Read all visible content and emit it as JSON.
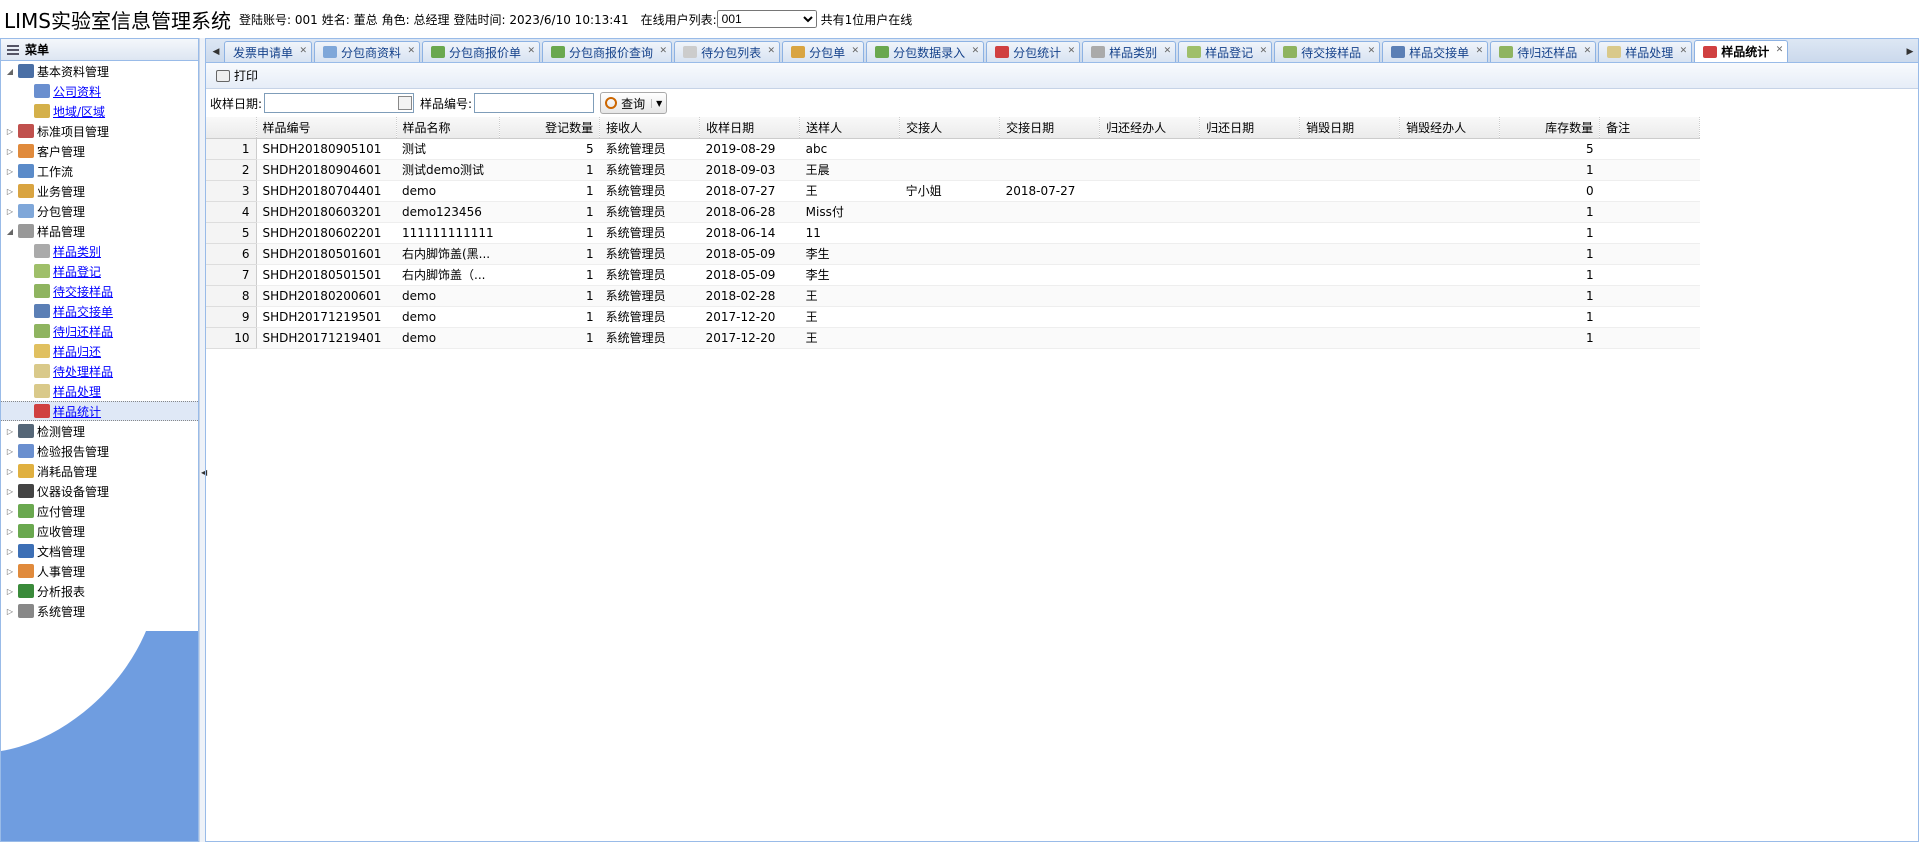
{
  "header": {
    "title": "LIMS实验室信息管理系统",
    "login_account": "登陆账号: 001",
    "name": "姓名: 董总",
    "role": "角色: 总经理",
    "login_time": "登陆时间: 2023/6/10 10:13:41",
    "online_label": "在线用户列表:",
    "online_selected": "001",
    "online_count": "共有1位用户在线"
  },
  "sidebar": {
    "title": "菜单",
    "items": [
      {
        "label": "基本资料管理",
        "expanded": true,
        "icon": "book-icon",
        "color": "#4a6fa5"
      },
      {
        "label": "公司资料",
        "child": true,
        "icon": "edit-icon",
        "color": "#6a8fcf"
      },
      {
        "label": "地域/区域",
        "child": true,
        "icon": "map-icon",
        "color": "#d4b04a"
      },
      {
        "label": "标准项目管理",
        "icon": "list-icon",
        "color": "#c0504d"
      },
      {
        "label": "客户管理",
        "icon": "user-icon",
        "color": "#e08a3c"
      },
      {
        "label": "工作流",
        "icon": "flow-icon",
        "color": "#5b8bc9"
      },
      {
        "label": "业务管理",
        "icon": "folder-icon",
        "color": "#d9a441"
      },
      {
        "label": "分包管理",
        "icon": "package-icon",
        "color": "#7fa7d9"
      },
      {
        "label": "样品管理",
        "expanded": true,
        "icon": "sample-icon",
        "color": "#999999"
      },
      {
        "label": "样品类别",
        "child": true,
        "icon": "sample-type-icon",
        "color": "#aaaaaa"
      },
      {
        "label": "样品登记",
        "child": true,
        "icon": "sample-register-icon",
        "color": "#9fbf6a"
      },
      {
        "label": "待交接样品",
        "child": true,
        "icon": "handover-icon",
        "color": "#8fb460"
      },
      {
        "label": "样品交接单",
        "child": true,
        "icon": "chart-icon",
        "color": "#5b7fb5"
      },
      {
        "label": "待归还样品",
        "child": true,
        "icon": "return-icon",
        "color": "#8fb460"
      },
      {
        "label": "样品归还",
        "child": true,
        "icon": "return-done-icon",
        "color": "#e0c060"
      },
      {
        "label": "待处理样品",
        "child": true,
        "icon": "pending-icon",
        "color": "#d9c98a"
      },
      {
        "label": "样品处理",
        "child": true,
        "icon": "process-icon",
        "color": "#d9c98a"
      },
      {
        "label": "样品统计",
        "child": true,
        "selected": true,
        "icon": "stats-icon",
        "color": "#d04040"
      },
      {
        "label": "检测管理",
        "icon": "test-icon",
        "color": "#556677"
      },
      {
        "label": "检验报告管理",
        "icon": "report-icon",
        "color": "#6a8fcf"
      },
      {
        "label": "消耗品管理",
        "icon": "box-icon",
        "color": "#e0b040"
      },
      {
        "label": "仪器设备管理",
        "icon": "device-icon",
        "color": "#444444"
      },
      {
        "label": "应付管理",
        "icon": "payable-icon",
        "color": "#6aa84f"
      },
      {
        "label": "应收管理",
        "icon": "receivable-icon",
        "color": "#6aa84f"
      },
      {
        "label": "文档管理",
        "icon": "doc-icon",
        "color": "#3d6fb5"
      },
      {
        "label": "人事管理",
        "icon": "people-icon",
        "color": "#e08a3c"
      },
      {
        "label": "分析报表",
        "icon": "excel-icon",
        "color": "#3a8a3a"
      },
      {
        "label": "系统管理",
        "icon": "gear-icon",
        "color": "#888888"
      }
    ]
  },
  "tabs": [
    {
      "label": "发票申请单",
      "icon": "none"
    },
    {
      "label": "分包商资料",
      "icon": "package-icon",
      "color": "#7fa7d9"
    },
    {
      "label": "分包商报价单",
      "icon": "quote-icon",
      "color": "#6aa84f"
    },
    {
      "label": "分包商报价查询",
      "icon": "quote-search-icon",
      "color": "#6aa84f"
    },
    {
      "label": "待分包列表",
      "icon": "doc-icon",
      "color": "#cccccc"
    },
    {
      "label": "分包单",
      "icon": "package-order-icon",
      "color": "#d9a441"
    },
    {
      "label": "分包数据录入",
      "icon": "data-entry-icon",
      "color": "#6aa84f"
    },
    {
      "label": "分包统计",
      "icon": "stats-icon",
      "color": "#d04040"
    },
    {
      "label": "样品类别",
      "icon": "sample-type-icon",
      "color": "#aaaaaa"
    },
    {
      "label": "样品登记",
      "icon": "sample-register-icon",
      "color": "#9fbf6a"
    },
    {
      "label": "待交接样品",
      "icon": "handover-icon",
      "color": "#8fb460"
    },
    {
      "label": "样品交接单",
      "icon": "chart-icon",
      "color": "#5b7fb5"
    },
    {
      "label": "待归还样品",
      "icon": "return-icon",
      "color": "#8fb460"
    },
    {
      "label": "样品处理",
      "icon": "process-icon",
      "color": "#d9c98a"
    },
    {
      "label": "样品统计",
      "icon": "stats-icon",
      "color": "#d04040",
      "active": true
    }
  ],
  "toolbar": {
    "print_label": "打印"
  },
  "search": {
    "date_label": "收样日期:",
    "date_value": "",
    "code_label": "样品编号:",
    "code_value": "",
    "query_label": "查询"
  },
  "grid": {
    "columns": [
      "样品编号",
      "样品名称",
      "登记数量",
      "接收人",
      "收样日期",
      "送样人",
      "交接人",
      "交接日期",
      "归还经办人",
      "归还日期",
      "销毁日期",
      "销毁经办人",
      "库存数量",
      "备注"
    ],
    "rows": [
      [
        "SHDH20180905101",
        "测试",
        "5",
        "系统管理员",
        "2019-08-29",
        "abc",
        "",
        "",
        "",
        "",
        "",
        "",
        "5",
        ""
      ],
      [
        "SHDH20180904601",
        "测试demo测试",
        "1",
        "系统管理员",
        "2018-09-03",
        "王晨",
        "",
        "",
        "",
        "",
        "",
        "",
        "1",
        ""
      ],
      [
        "SHDH20180704401",
        "demo",
        "1",
        "系统管理员",
        "2018-07-27",
        "王",
        "宁小姐",
        "2018-07-27",
        "",
        "",
        "",
        "",
        "0",
        ""
      ],
      [
        "SHDH20180603201",
        "demo123456",
        "1",
        "系统管理员",
        "2018-06-28",
        "Miss付",
        "",
        "",
        "",
        "",
        "",
        "",
        "1",
        ""
      ],
      [
        "SHDH20180602201",
        "111111111111",
        "1",
        "系统管理员",
        "2018-06-14",
        "11",
        "",
        "",
        "",
        "",
        "",
        "",
        "1",
        ""
      ],
      [
        "SHDH20180501601",
        "右内脚饰盖(黑...",
        "1",
        "系统管理员",
        "2018-05-09",
        "李生",
        "",
        "",
        "",
        "",
        "",
        "",
        "1",
        ""
      ],
      [
        "SHDH20180501501",
        "右内脚饰盖（...",
        "1",
        "系统管理员",
        "2018-05-09",
        "李生",
        "",
        "",
        "",
        "",
        "",
        "",
        "1",
        ""
      ],
      [
        "SHDH20180200601",
        "demo",
        "1",
        "系统管理员",
        "2018-02-28",
        "王",
        "",
        "",
        "",
        "",
        "",
        "",
        "1",
        ""
      ],
      [
        "SHDH20171219501",
        "demo",
        "1",
        "系统管理员",
        "2017-12-20",
        "王",
        "",
        "",
        "",
        "",
        "",
        "",
        "1",
        ""
      ],
      [
        "SHDH20171219401",
        "demo",
        "1",
        "系统管理员",
        "2017-12-20",
        "王",
        "",
        "",
        "",
        "",
        "",
        "",
        "1",
        ""
      ]
    ]
  },
  "colors": {
    "panel_border": "#99bbe8",
    "selected_bg": "#dfe8f6",
    "wave": "#6f9de0",
    "link": "#0000ff"
  }
}
